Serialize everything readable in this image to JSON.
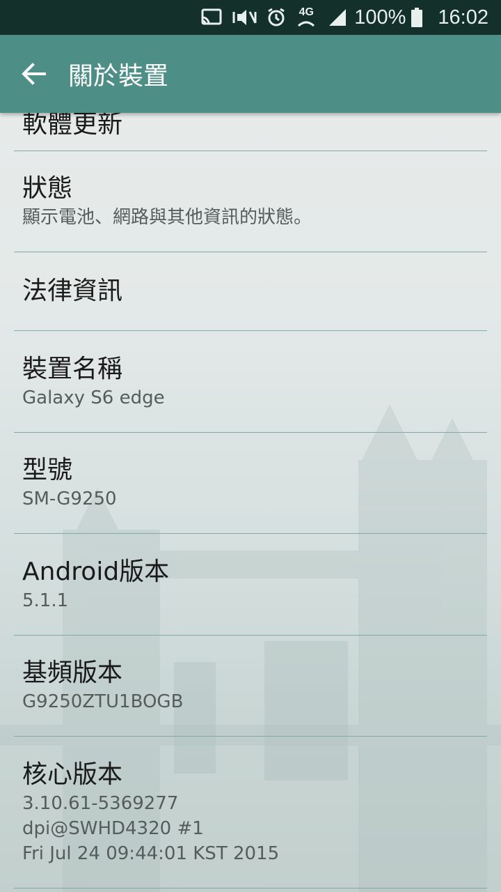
{
  "status_bar": {
    "battery": "100%",
    "time": "16:02",
    "network": "4G",
    "icons": [
      "cast-icon",
      "mute-vibrate-icon",
      "alarm-icon",
      "4g-data-icon",
      "signal-icon",
      "battery-icon"
    ]
  },
  "app_bar": {
    "title": "關於裝置",
    "back_icon": "back-arrow-icon"
  },
  "colors": {
    "status_bar_bg": "#14302b",
    "app_bar_bg": "#4d8f86",
    "divider": "#82aaa5"
  },
  "items": [
    {
      "title": "軟體更新",
      "subtitle": ""
    },
    {
      "title": "狀態",
      "subtitle": "顯示電池、網路與其他資訊的狀態。"
    },
    {
      "title": "法律資訊",
      "subtitle": ""
    },
    {
      "title": "裝置名稱",
      "subtitle": "Galaxy S6 edge"
    },
    {
      "title": "型號",
      "subtitle": "SM-G9250"
    },
    {
      "title": "Android版本",
      "subtitle": "5.1.1"
    },
    {
      "title": "基頻版本",
      "subtitle": "G9250ZTU1BOGB"
    },
    {
      "title": "核心版本",
      "subtitle": "3.10.61-5369277\ndpi@SWHD4320 #1\nFri Jul 24 09:44:01 KST 2015"
    }
  ]
}
